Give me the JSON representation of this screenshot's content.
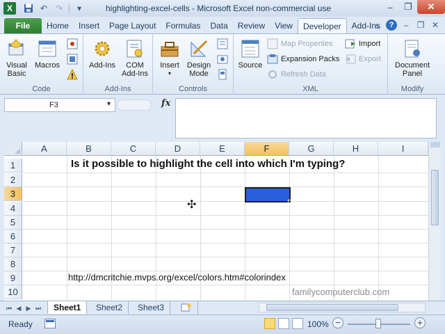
{
  "window": {
    "title": "highlighting-excel-cells  -  Microsoft Excel non-commercial use",
    "app_icon": "X",
    "qat": [
      "save-icon",
      "undo-icon",
      "redo-icon",
      "customize-icon"
    ],
    "controls": {
      "minimize": "–",
      "restore": "❐",
      "close": "✕"
    }
  },
  "ribbon_tabs": {
    "file": "File",
    "items": [
      "Home",
      "Insert",
      "Page Layout",
      "Formulas",
      "Data",
      "Review",
      "View",
      "Developer",
      "Add-Ins"
    ],
    "active": "Developer"
  },
  "ribbon": {
    "code": {
      "label": "Code",
      "visual_basic": "Visual Basic",
      "macros": "Macros"
    },
    "addins": {
      "label": "Add-Ins",
      "addins": "Add-Ins",
      "com_addins": "COM Add-Ins"
    },
    "controls": {
      "label": "Controls",
      "insert": "Insert",
      "design_mode": "Design Mode"
    },
    "xml": {
      "label": "XML",
      "source": "Source",
      "map_properties": "Map Properties",
      "expansion_packs": "Expansion Packs",
      "refresh_data": "Refresh Data",
      "import": "Import",
      "export": "Export"
    },
    "modify": {
      "label": "Modify",
      "document_panel": "Document Panel"
    }
  },
  "formula_bar": {
    "name_box": "F3",
    "fx": "fx",
    "formula": ""
  },
  "grid": {
    "columns": [
      "A",
      "B",
      "C",
      "D",
      "E",
      "F",
      "G",
      "H",
      "I"
    ],
    "rows": [
      "1",
      "2",
      "3",
      "4",
      "5",
      "6",
      "7",
      "8",
      "9",
      "10"
    ],
    "selected_column": "F",
    "selected_row": "3",
    "headline": "Is it possible to highlight the cell into which I'm typing?",
    "url": "http://dmcritchie.mvps.org/excel/colors.htm#colorindex",
    "watermark": "familycomputerclub.com",
    "active_cell_color": "#2a5fdb"
  },
  "sheets": {
    "tabs": [
      "Sheet1",
      "Sheet2",
      "Sheet3"
    ],
    "active": "Sheet1"
  },
  "status_bar": {
    "ready": "Ready",
    "zoom": "100%",
    "zoom_minus": "−",
    "zoom_plus": "+"
  }
}
